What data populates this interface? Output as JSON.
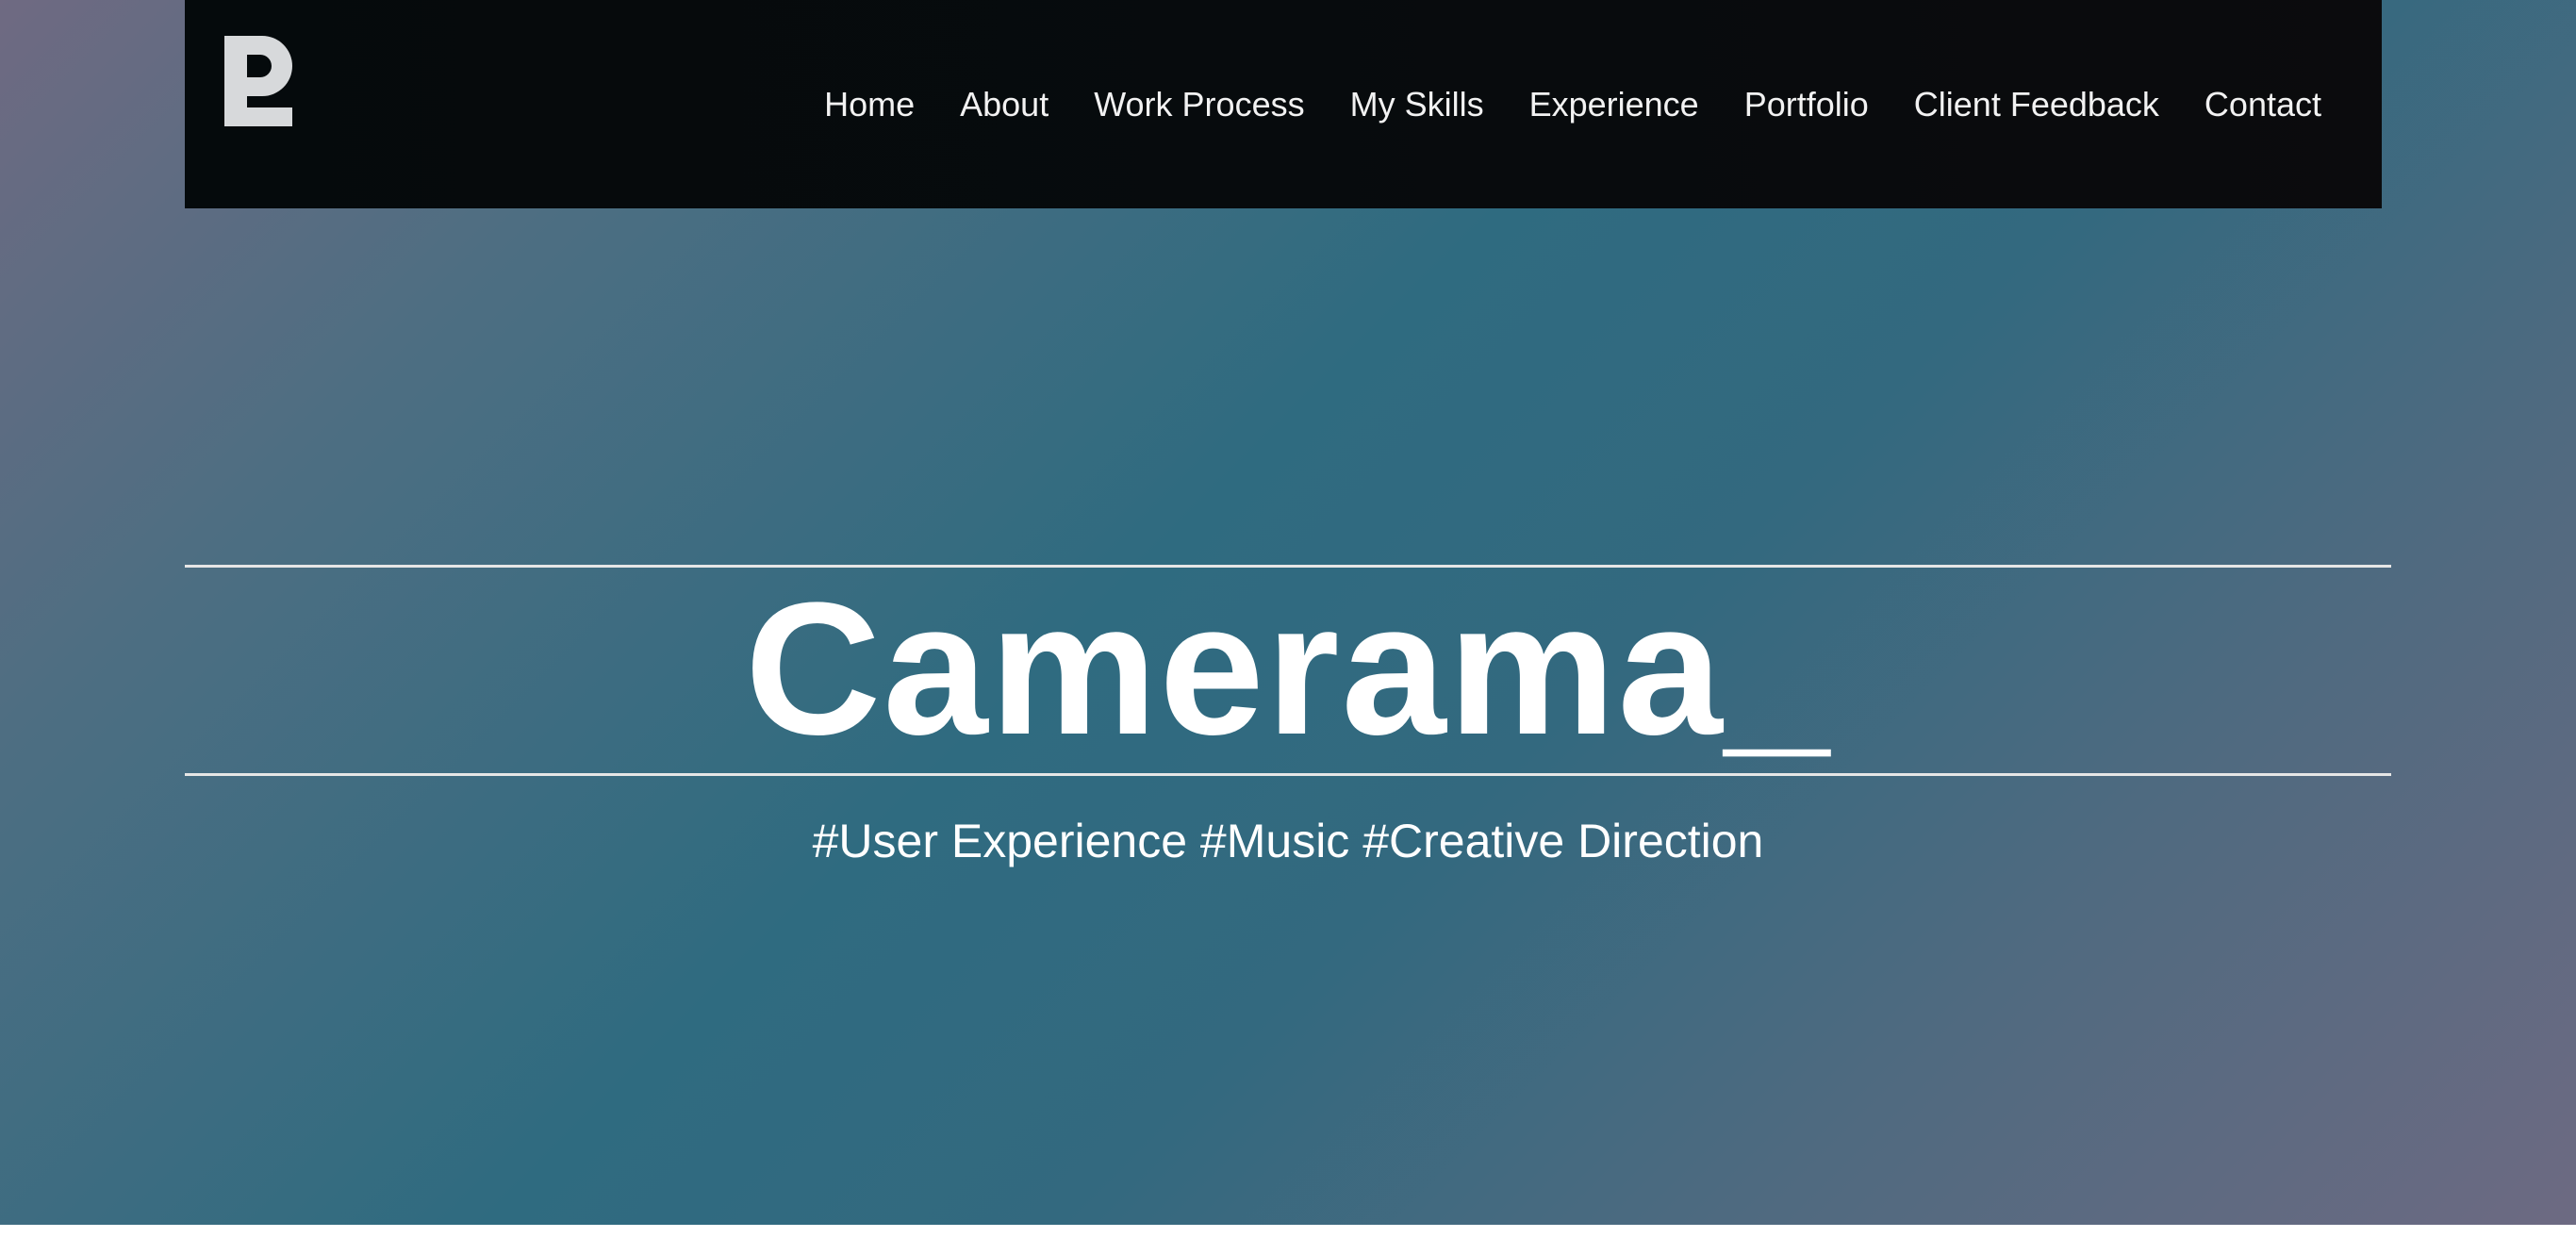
{
  "brand": {
    "logo_icon": "p-logo-icon",
    "logo_color": "#d7d9db"
  },
  "nav": {
    "items": [
      {
        "label": "Home"
      },
      {
        "label": "About"
      },
      {
        "label": "Work Process"
      },
      {
        "label": "My Skills"
      },
      {
        "label": "Experience"
      },
      {
        "label": "Portfolio"
      },
      {
        "label": "Client Feedback"
      },
      {
        "label": "Contact"
      }
    ]
  },
  "hero": {
    "title": "Camerama",
    "cursor": "_",
    "tagline": "#User Experience #Music #Creative Direction"
  },
  "colors": {
    "navbar_bg": "#070b0d",
    "hero_teal": "#2f6b80",
    "hero_mauve": "#6f6a82",
    "text": "#ffffff"
  }
}
